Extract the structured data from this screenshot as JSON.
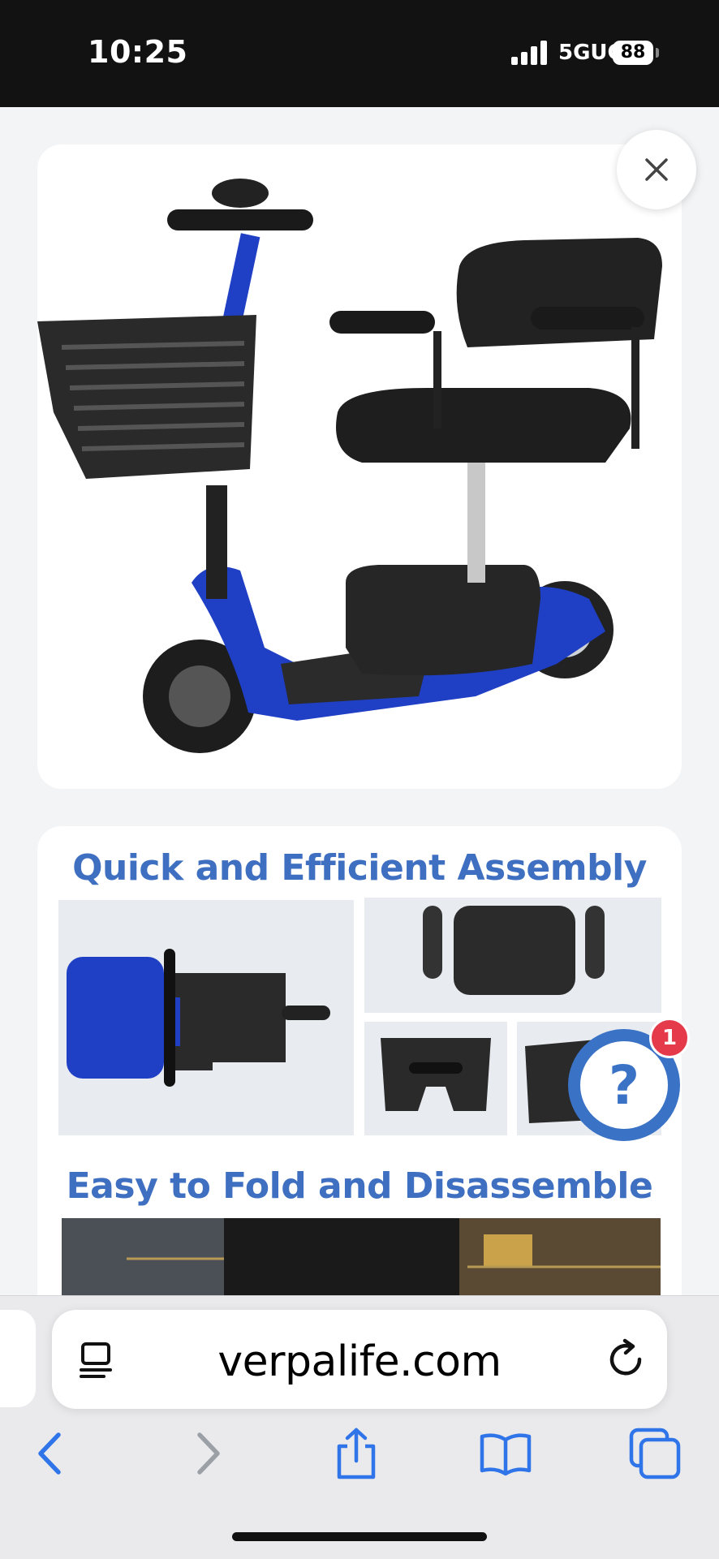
{
  "status_bar": {
    "time": "10:25",
    "network": "5GUC",
    "battery": "88"
  },
  "product": {
    "image_description_icon": "scooter-image",
    "close_icon": "close-icon"
  },
  "info": {
    "heading_assembly": "Quick and Efficient Assembly",
    "heading_fold": "Easy to Fold and Disassemble"
  },
  "help": {
    "label": "?",
    "badge": "1"
  },
  "browser": {
    "url": "verpalife.com",
    "toolbar": [
      "back-icon",
      "forward-icon",
      "share-icon",
      "bookmarks-icon",
      "tabs-icon"
    ]
  },
  "colors": {
    "accent": "#3f6fc0",
    "fab": "#3a72c6",
    "badge": "#e53a4a",
    "scooter_blue": "#1f3fc4"
  }
}
